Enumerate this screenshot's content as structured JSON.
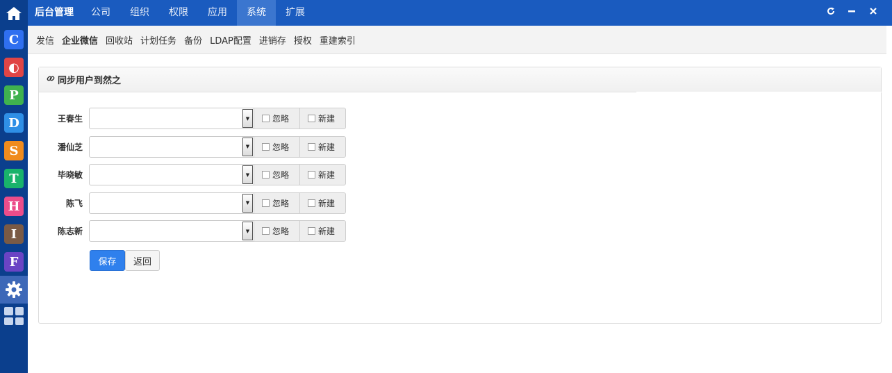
{
  "topbar": {
    "brand": "后台管理",
    "tabs": [
      "公司",
      "组织",
      "权限",
      "应用",
      "系统",
      "扩展"
    ],
    "active_tab": "系统"
  },
  "dock": {
    "apps": [
      {
        "letter": "C",
        "color": "#2f6ff0",
        "icon": "c-app-icon"
      },
      {
        "letter": "◐",
        "color": "#e04545",
        "icon": "half-circle-app-icon"
      },
      {
        "letter": "P",
        "color": "#3fb24f",
        "icon": "p-app-icon"
      },
      {
        "letter": "D",
        "color": "#2f8fe6",
        "icon": "d-app-icon"
      },
      {
        "letter": "S",
        "color": "#f08b1d",
        "icon": "s-app-icon"
      },
      {
        "letter": "T",
        "color": "#19b36b",
        "icon": "t-app-icon"
      },
      {
        "letter": "H",
        "color": "#ec4d8a",
        "icon": "h-app-icon"
      },
      {
        "letter": "I",
        "color": "#7a5a45",
        "icon": "i-app-icon"
      },
      {
        "letter": "F",
        "color": "#6a44c4",
        "icon": "f-app-icon"
      }
    ]
  },
  "subnav": {
    "items": [
      "发信",
      "企业微信",
      "回收站",
      "计划任务",
      "备份",
      "LDAP配置",
      "进销存",
      "授权",
      "重建索引"
    ],
    "active": "企业微信"
  },
  "panel": {
    "title": "同步用户到然之"
  },
  "users": [
    {
      "name": "王春生",
      "selected": ""
    },
    {
      "name": "潘仙芝",
      "selected": ""
    },
    {
      "name": "毕晓敏",
      "selected": ""
    },
    {
      "name": "陈飞",
      "selected": ""
    },
    {
      "name": "陈志新",
      "selected": ""
    }
  ],
  "options": {
    "ignore_label": "忽略",
    "new_label": "新建"
  },
  "actions": {
    "save_label": "保存",
    "back_label": "返回"
  },
  "colors": {
    "topbar": "#1a5bbf",
    "active_tab": "#3b76cf",
    "dock": "#0b3f8d",
    "primary": "#2f80ed"
  }
}
